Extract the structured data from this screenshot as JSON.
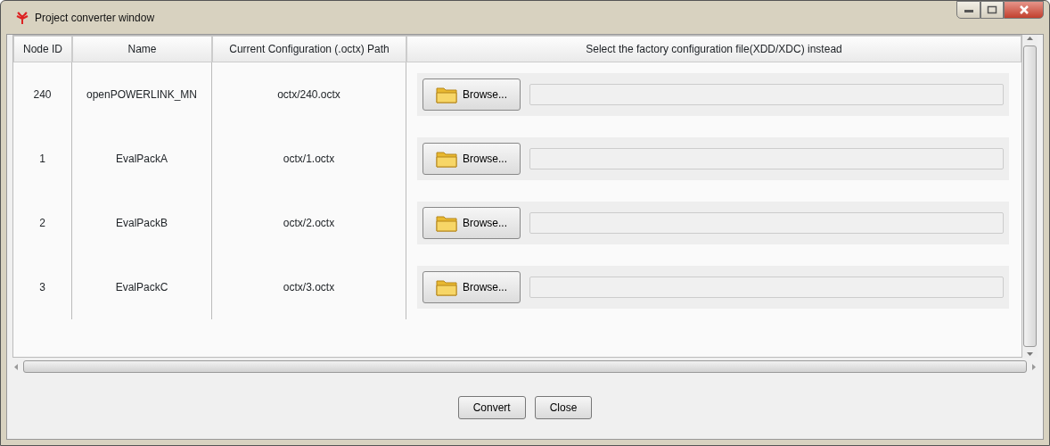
{
  "window": {
    "title": "Project converter window"
  },
  "table": {
    "columns": [
      "Node ID",
      "Name",
      "Current Configuration (.octx) Path",
      "Select the factory configuration file(XDD/XDC) instead"
    ],
    "rows": [
      {
        "node_id": "240",
        "name": "openPOWERLINK_MN",
        "path": "octx/240.octx",
        "browse": "Browse..."
      },
      {
        "node_id": "1",
        "name": "EvalPackA",
        "path": "octx/1.octx",
        "browse": "Browse..."
      },
      {
        "node_id": "2",
        "name": "EvalPackB",
        "path": "octx/2.octx",
        "browse": "Browse..."
      },
      {
        "node_id": "3",
        "name": "EvalPackC",
        "path": "octx/3.octx",
        "browse": "Browse..."
      }
    ]
  },
  "buttons": [
    "Convert",
    "Close"
  ]
}
